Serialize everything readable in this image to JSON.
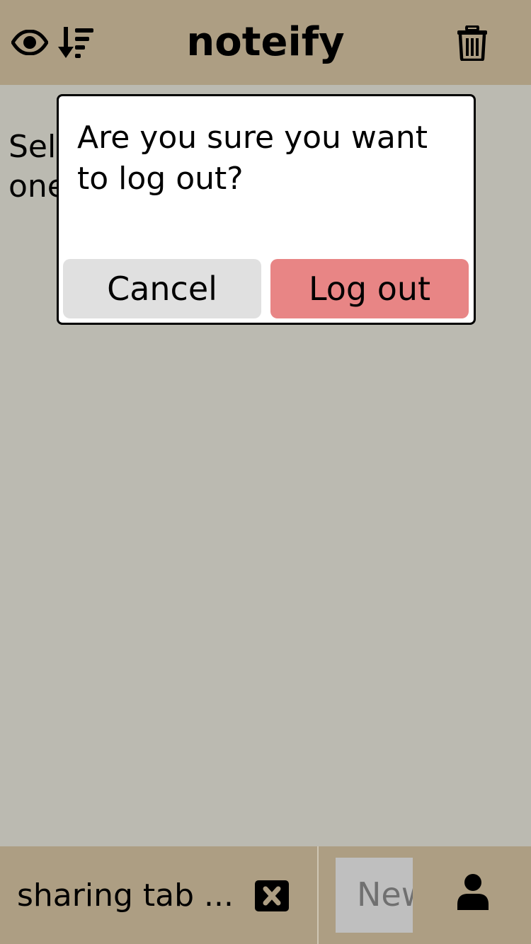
{
  "header": {
    "title": "noteify",
    "icons": {
      "toggle_view": "eye-icon",
      "sort": "sort-descending-icon",
      "delete": "trash-icon"
    }
  },
  "background": {
    "empty_message": "Select a note or create a new one"
  },
  "dialog": {
    "message": "Are you sure you want to log out?",
    "cancel_label": "Cancel",
    "confirm_label": "Log out",
    "confirm_color": "#e88585",
    "cancel_color": "#e0e0e0"
  },
  "footer": {
    "tab_label": "sharing tab ...",
    "tab_close_icon": "close-icon",
    "new_tab_label": "New",
    "user_icon": "user-icon"
  },
  "colors": {
    "bar": "#ad9e83",
    "content_bg": "#bbbab1"
  }
}
